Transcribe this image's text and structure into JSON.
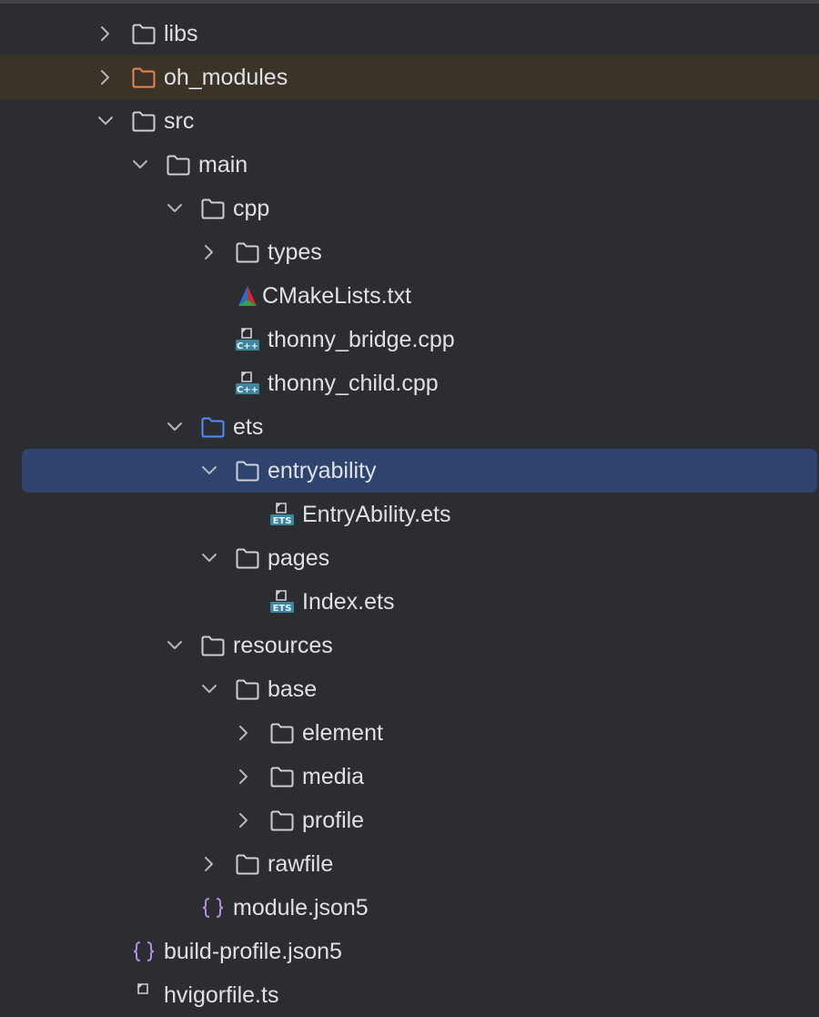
{
  "colors": {
    "background": "#2b2d30",
    "text": "#dfe1e5",
    "chevron": "#b4b8bf",
    "folder": "#ced0d6",
    "folder_excluded": "#e08855",
    "folder_source": "#548af7",
    "selection": "#2e436e",
    "excluded_row": "#3b3328",
    "cpp_icon": "#3e86a0",
    "json_icon": "#b18ce6"
  },
  "tree": {
    "items": [
      {
        "label": "libs",
        "depth": 0,
        "chevron": "right",
        "icon": "folder-icon"
      },
      {
        "label": "oh_modules",
        "depth": 0,
        "chevron": "right",
        "icon": "folder-icon",
        "variant": "excluded"
      },
      {
        "label": "src",
        "depth": 0,
        "chevron": "down",
        "icon": "folder-icon"
      },
      {
        "label": "main",
        "depth": 1,
        "chevron": "down",
        "icon": "folder-icon"
      },
      {
        "label": "cpp",
        "depth": 2,
        "chevron": "down",
        "icon": "folder-icon"
      },
      {
        "label": "types",
        "depth": 3,
        "chevron": "right",
        "icon": "folder-icon"
      },
      {
        "label": "CMakeLists.txt",
        "depth": 3,
        "chevron": "none",
        "icon": "cmake-icon"
      },
      {
        "label": "thonny_bridge.cpp",
        "depth": 3,
        "chevron": "none",
        "icon": "cpp-file-icon"
      },
      {
        "label": "thonny_child.cpp",
        "depth": 3,
        "chevron": "none",
        "icon": "cpp-file-icon"
      },
      {
        "label": "ets",
        "depth": 2,
        "chevron": "down",
        "icon": "folder-icon",
        "variant": "source"
      },
      {
        "label": "entryability",
        "depth": 3,
        "chevron": "down",
        "icon": "folder-icon",
        "selected": true
      },
      {
        "label": "EntryAbility.ets",
        "depth": 4,
        "chevron": "none",
        "icon": "ets-file-icon"
      },
      {
        "label": "pages",
        "depth": 3,
        "chevron": "down",
        "icon": "folder-icon"
      },
      {
        "label": "Index.ets",
        "depth": 4,
        "chevron": "none",
        "icon": "ets-file-icon"
      },
      {
        "label": "resources",
        "depth": 2,
        "chevron": "down",
        "icon": "folder-icon"
      },
      {
        "label": "base",
        "depth": 3,
        "chevron": "down",
        "icon": "folder-icon"
      },
      {
        "label": "element",
        "depth": 4,
        "chevron": "right",
        "icon": "folder-icon"
      },
      {
        "label": "media",
        "depth": 4,
        "chevron": "right",
        "icon": "folder-icon"
      },
      {
        "label": "profile",
        "depth": 4,
        "chevron": "right",
        "icon": "folder-icon"
      },
      {
        "label": "rawfile",
        "depth": 3,
        "chevron": "right",
        "icon": "folder-icon"
      },
      {
        "label": "module.json5",
        "depth": 2,
        "chevron": "none",
        "icon": "json-file-icon"
      },
      {
        "label": "build-profile.json5",
        "depth": 0,
        "chevron": "none",
        "icon": "json-file-icon"
      },
      {
        "label": "hvigorfile.ts",
        "depth": 0,
        "chevron": "none",
        "icon": "file-icon"
      }
    ]
  }
}
